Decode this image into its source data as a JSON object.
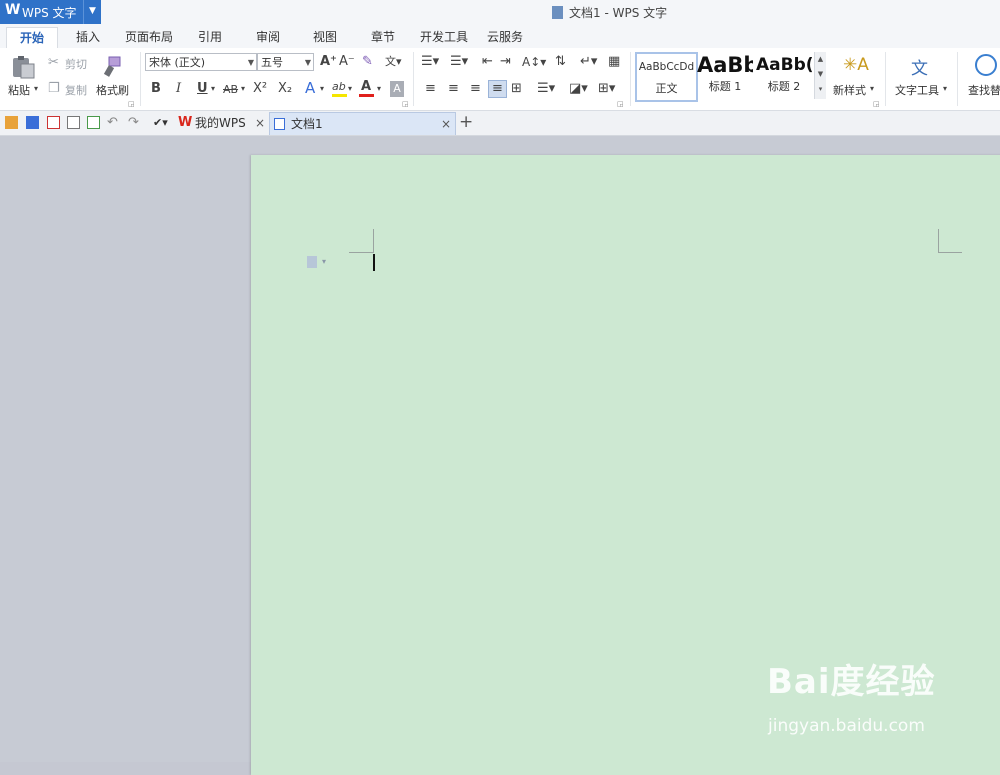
{
  "app": {
    "name": "WPS 文字",
    "logo": "W"
  },
  "window": {
    "title": "文档1 - WPS 文字"
  },
  "menu_tabs": [
    {
      "label": "开始",
      "active": true
    },
    {
      "label": "插入"
    },
    {
      "label": "页面布局"
    },
    {
      "label": "引用"
    },
    {
      "label": "审阅"
    },
    {
      "label": "视图"
    },
    {
      "label": "章节"
    },
    {
      "label": "开发工具"
    },
    {
      "label": "云服务"
    }
  ],
  "clipboard": {
    "paste": "粘贴",
    "cut": "剪切",
    "copy": "复制",
    "format_painter": "格式刷"
  },
  "font": {
    "name": "宋体 (正文)",
    "size": "五号",
    "bold": "B",
    "italic": "I",
    "underline": "U",
    "strikethrough": "AB",
    "superscript": "X²",
    "subscript": "X₂",
    "grow": "A⁺",
    "shrink": "A⁻",
    "color_letter": "A",
    "highlight_letter": "ab",
    "text_effect": "A",
    "char_shading": "A"
  },
  "styles": [
    {
      "preview": "AaBbCcDd",
      "label": "正文"
    },
    {
      "preview": "AaBb",
      "label": "标题 1"
    },
    {
      "preview": "AaBb(",
      "label": "标题 2"
    }
  ],
  "new_style": "新样式",
  "text_tools": "文字工具",
  "find_replace": "查找替",
  "tabs": {
    "home": "我的WPS",
    "document": "文档1"
  },
  "colors": {
    "accent": "#2f72c8",
    "page": "#cde8d2",
    "workspace": "#c7cbd4",
    "font_color_bar": "#e0201c",
    "highlight_bar": "#f5e600"
  },
  "watermark": {
    "brand": "Bai度经验",
    "url": "jingyan.baidu.com"
  }
}
